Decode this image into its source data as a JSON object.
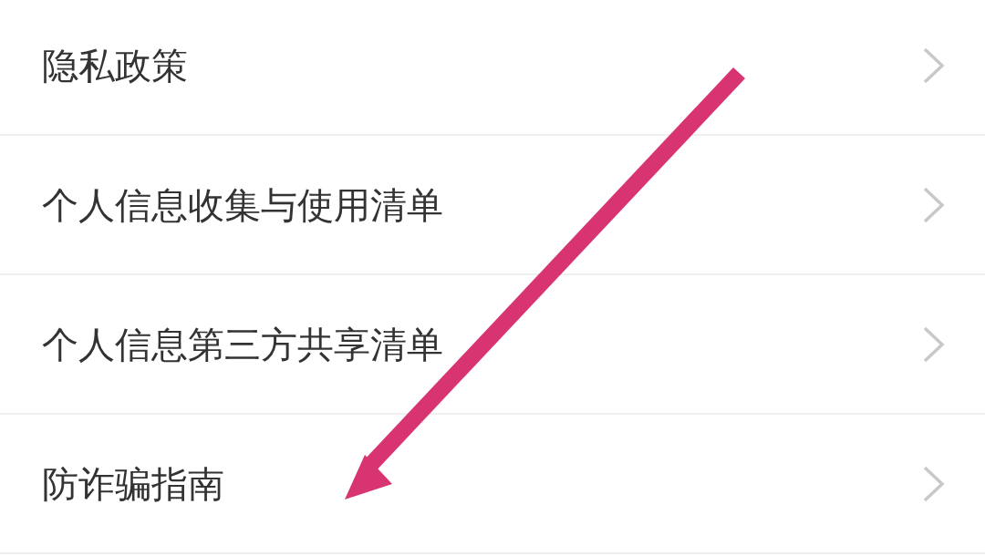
{
  "menu_items": [
    {
      "label": "隐私政策"
    },
    {
      "label": "个人信息收集与使用清单"
    },
    {
      "label": "个人信息第三方共享清单"
    },
    {
      "label": "防诈骗指南"
    }
  ]
}
